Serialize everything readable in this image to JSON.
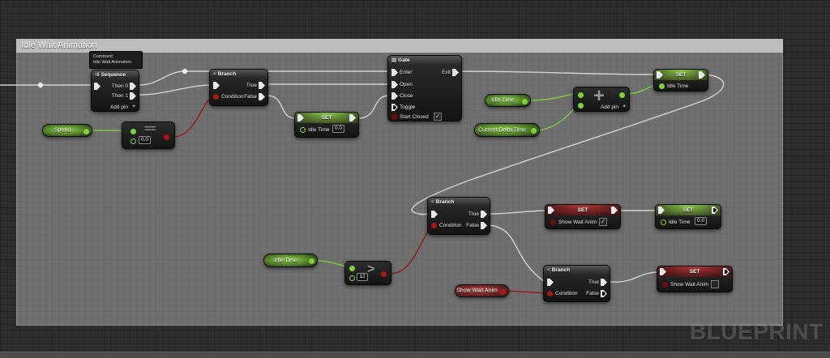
{
  "comment_box": {
    "title": "Idle Wait Animation"
  },
  "comment_bubble": {
    "line1": "Comment:",
    "line2": "Idle Wait Animation"
  },
  "watermark": "BLUEPRINT",
  "colors": {
    "exec_wire": "#d8d8d8",
    "float_wire_green": "#7ed33c",
    "bool_wire_red": "#941111",
    "set_float_header_green": "#8cc84b",
    "set_bool_header_red": "#b23535",
    "background": "#2d2d2d"
  },
  "icons": {
    "sequence_icon": "⇉",
    "branch_icon": "<",
    "gate_icon": "▤",
    "plus_icon": "+",
    "add_glyph": "+",
    "equal_glyph": "==",
    "greater_glyph": ">",
    "check_glyph": "✓"
  },
  "nodes": {
    "sequence": {
      "title": "Sequence",
      "then0": "Then 0",
      "then1": "Then 1",
      "add_pin": "Add pin"
    },
    "branch_top": {
      "title": "Branch",
      "condition": "Condition",
      "true_label": "True",
      "false_label": "False"
    },
    "branch_mid": {
      "title": "Branch",
      "condition": "Condition",
      "true_label": "True",
      "false_label": "False"
    },
    "branch_bottom": {
      "title": "Branch",
      "condition": "Condition",
      "true_label": "True",
      "false_label": "False"
    },
    "gate": {
      "title": "Gate",
      "enter": "Enter",
      "exit": "Exit",
      "open": "Open",
      "close": "Close",
      "toggle": "Toggle",
      "start_closed": "Start Closed",
      "start_closed_check": "✓"
    },
    "set_idle_mid": {
      "title": "SET",
      "pin": "Idle Time",
      "value": "0.0"
    },
    "set_idle_topright": {
      "title": "SET",
      "pin": "Idle Time"
    },
    "set_show_true": {
      "title": "SET",
      "pin": "Show Wait Anim",
      "check": "✓"
    },
    "set_idle_right": {
      "title": "SET",
      "pin": "Idle Time",
      "value": "0.0"
    },
    "set_show_false": {
      "title": "SET",
      "pin": "Show Wait Anim",
      "check": ""
    },
    "equals_node": {
      "glyph": "==",
      "value": "0.0"
    },
    "greater_node": {
      "glyph": ">",
      "value": "12"
    },
    "add_node": {
      "glyph": "+",
      "add_pin": "Add pin"
    }
  },
  "pills": {
    "speed": "Speed",
    "idle_time_top": "Idle Time",
    "current_delta_time": "Current Delta Time",
    "idle_time_bottom": "Idle Time",
    "show_wait_anim": "Show Wait Anim"
  }
}
